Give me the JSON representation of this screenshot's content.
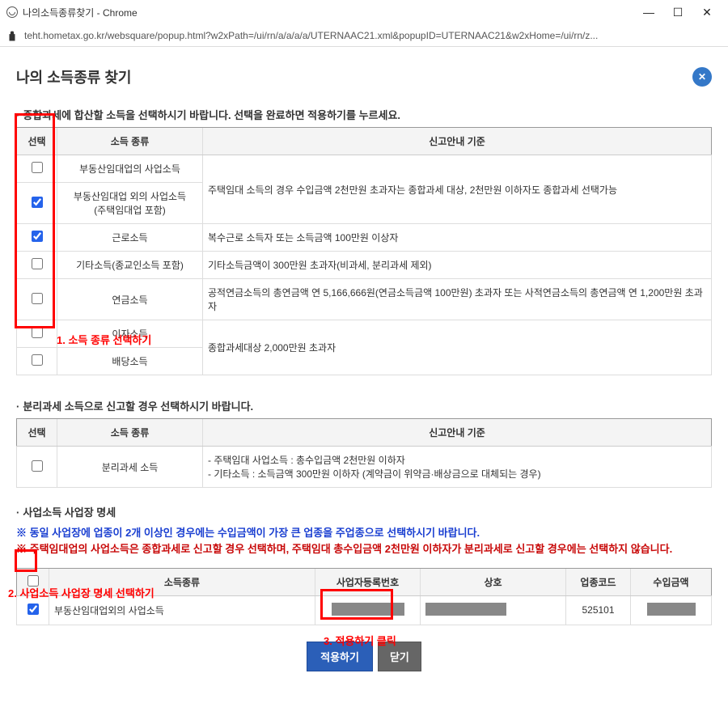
{
  "window": {
    "title": "나의소득종류찾기 - Chrome",
    "url": "teht.hometax.go.kr/websquare/popup.html?w2xPath=/ui/rn/a/a/a/a/UTERNAAC21.xml&popupID=UTERNAAC21&w2xHome=/ui/rn/z..."
  },
  "page": {
    "title": "나의 소득종류 찾기"
  },
  "section1": {
    "title": "종합과세에 합산할 소득을 선택하시기 바랍니다. 선택을 완료하면 적용하기를 누르세요.",
    "headers": {
      "sel": "선택",
      "type": "소득 종류",
      "guide": "신고안내 기준"
    },
    "rows": [
      {
        "checked": false,
        "type": "부동산임대업의 사업소득",
        "guide_rowspan": 2,
        "guide": ""
      },
      {
        "checked": true,
        "type": "부동산임대업 외의 사업소득\n(주택임대업 포함)",
        "guide": "주택임대 소득의 경우 수입금액 2천만원 초과자는 종합과세 대상, 2천만원 이하자도 종합과세 선택가능"
      },
      {
        "checked": true,
        "type": "근로소득",
        "guide": "복수근로 소득자 또는 소득금액 100만원 이상자"
      },
      {
        "checked": false,
        "type": "기타소득(종교인소득 포함)",
        "guide": "기타소득금액이 300만원 초과자(비과세, 분리과세 제외)"
      },
      {
        "checked": false,
        "type": "연금소득",
        "guide": "공적연금소득의 총연금액 연 5,166,666원(연금소득금액 100만원) 초과자 또는 사적연금소득의 총연금액 연 1,200만원 초과자"
      },
      {
        "checked": false,
        "type": "이자소득",
        "guide_rowspan": 2,
        "guide": "종합과세대상 2,000만원 초과자"
      },
      {
        "checked": false,
        "type": "배당소득"
      }
    ]
  },
  "section2": {
    "title": "분리과세 소득으로 신고할 경우 선택하시기 바랍니다.",
    "headers": {
      "sel": "선택",
      "type": "소득 종류",
      "guide": "신고안내 기준"
    },
    "row": {
      "checked": false,
      "type": "분리과세 소득",
      "guide_line1": "- 주택임대 사업소득 : 총수입금액 2천만원 이하자",
      "guide_line2": "- 기타소득 : 소득금액 300만원 이하자 (계약금이 위약금·배상금으로 대체되는 경우)"
    }
  },
  "section3": {
    "title": "사업소득 사업장 명세",
    "note1": "※ 동일 사업장에 업종이 2개 이상인 경우에는 수입금액이 가장 큰 업종을 주업종으로 선택하시기 바랍니다.",
    "note2": "※ 주택임대업의 사업소득은 종합과세로 신고할 경우 선택하며, 주택임대 총수입금액 2천만원 이하자가 분리과세로 신고할 경우에는 선택하지 않습니다.",
    "headers": {
      "sel": "",
      "type": "소득종류",
      "bizno": "사업자등록번호",
      "name": "상호",
      "code": "업종코드",
      "amt": "수입금액"
    },
    "row": {
      "checked": true,
      "type": "부동산임대업외의 사업소득",
      "code": "525101"
    }
  },
  "buttons": {
    "apply": "적용하기",
    "close": "닫기"
  },
  "annotations": {
    "a1": "1. 소득 종류 선택하기",
    "a2": "2. 사업소득 사업장 명세 선택하기",
    "a3": "3. 적용하기 클릭"
  }
}
